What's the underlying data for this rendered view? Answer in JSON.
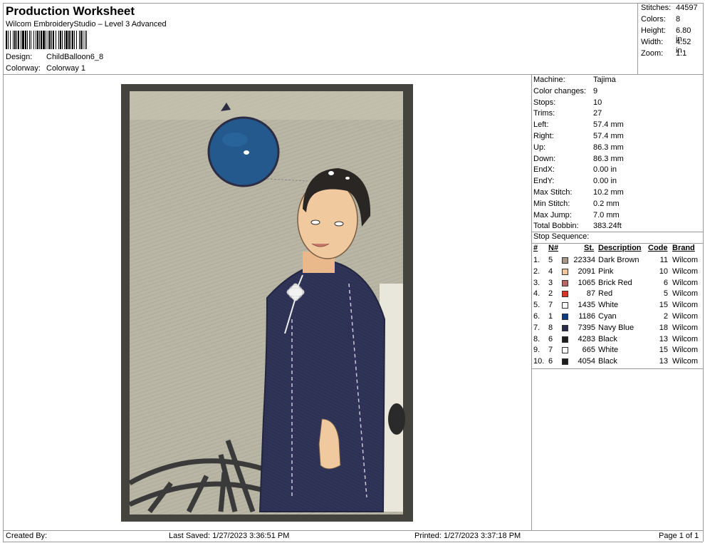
{
  "header": {
    "title": "Production Worksheet",
    "software": "Wilcom EmbroideryStudio – Level 3 Advanced",
    "design_label": "Design:",
    "design_value": "ChildBalloon6_8",
    "colorway_label": "Colorway:",
    "colorway_value": "Colorway 1"
  },
  "stats": [
    {
      "label": "Stitches:",
      "value": "44597"
    },
    {
      "label": "Colors:",
      "value": "8"
    },
    {
      "label": "Height:",
      "value": "6.80 in"
    },
    {
      "label": "Width:",
      "value": "4.52 in"
    },
    {
      "label": "Zoom:",
      "value": "1:1"
    }
  ],
  "machine_info": [
    {
      "label": "Machine:",
      "value": "Tajima"
    },
    {
      "label": "Color changes:",
      "value": "9"
    },
    {
      "label": "Stops:",
      "value": "10"
    },
    {
      "label": "Trims:",
      "value": "27"
    },
    {
      "label": "Left:",
      "value": "57.4 mm"
    },
    {
      "label": "Right:",
      "value": "57.4 mm"
    },
    {
      "label": "Up:",
      "value": "86.3 mm"
    },
    {
      "label": "Down:",
      "value": "86.3 mm"
    },
    {
      "label": "EndX:",
      "value": "0.00 in"
    },
    {
      "label": "EndY:",
      "value": "0.00 in"
    },
    {
      "label": "Max Stitch:",
      "value": "10.2 mm"
    },
    {
      "label": "Min Stitch:",
      "value": "0.2 mm"
    },
    {
      "label": "Max Jump:",
      "value": "7.0 mm"
    },
    {
      "label": "Total Bobbin:",
      "value": "383.24ft"
    }
  ],
  "stop_sequence": {
    "title": "Stop Sequence:",
    "columns": {
      "num": "#",
      "needle": "N#",
      "code_st": "St.",
      "description": "Description",
      "code": "Code",
      "brand": "Brand"
    },
    "rows": [
      {
        "num": "1.",
        "needle": "5",
        "color": "#a89888",
        "st": "22334",
        "description": "Dark Brown",
        "code": "11",
        "brand": "Wilcom"
      },
      {
        "num": "2.",
        "needle": "4",
        "color": "#f2c49a",
        "st": "2091",
        "description": "Pink",
        "code": "10",
        "brand": "Wilcom"
      },
      {
        "num": "3.",
        "needle": "3",
        "color": "#b86a62",
        "st": "1065",
        "description": "Brick Red",
        "code": "6",
        "brand": "Wilcom"
      },
      {
        "num": "4.",
        "needle": "2",
        "color": "#d8352a",
        "st": "87",
        "description": "Red",
        "code": "5",
        "brand": "Wilcom"
      },
      {
        "num": "5.",
        "needle": "7",
        "color": "#ffffff",
        "st": "1435",
        "description": "White",
        "code": "15",
        "brand": "Wilcom"
      },
      {
        "num": "6.",
        "needle": "1",
        "color": "#0b3d78",
        "st": "1186",
        "description": "Cyan",
        "code": "2",
        "brand": "Wilcom"
      },
      {
        "num": "7.",
        "needle": "8",
        "color": "#2a2a4a",
        "st": "7395",
        "description": "Navy Blue",
        "code": "18",
        "brand": "Wilcom"
      },
      {
        "num": "8.",
        "needle": "6",
        "color": "#1e1e1e",
        "st": "4283",
        "description": "Black",
        "code": "13",
        "brand": "Wilcom"
      },
      {
        "num": "9.",
        "needle": "7",
        "color": "#ffffff",
        "st": "665",
        "description": "White",
        "code": "15",
        "brand": "Wilcom"
      },
      {
        "num": "10.",
        "needle": "6",
        "color": "#1e1e1e",
        "st": "4054",
        "description": "Black",
        "code": "13",
        "brand": "Wilcom"
      }
    ]
  },
  "footer": {
    "created_by": "Created By:",
    "last_saved": "Last Saved: 1/27/2023 3:36:51 PM",
    "printed": "Printed: 1/27/2023 3:37:18 PM",
    "page": "Page 1 of 1"
  }
}
